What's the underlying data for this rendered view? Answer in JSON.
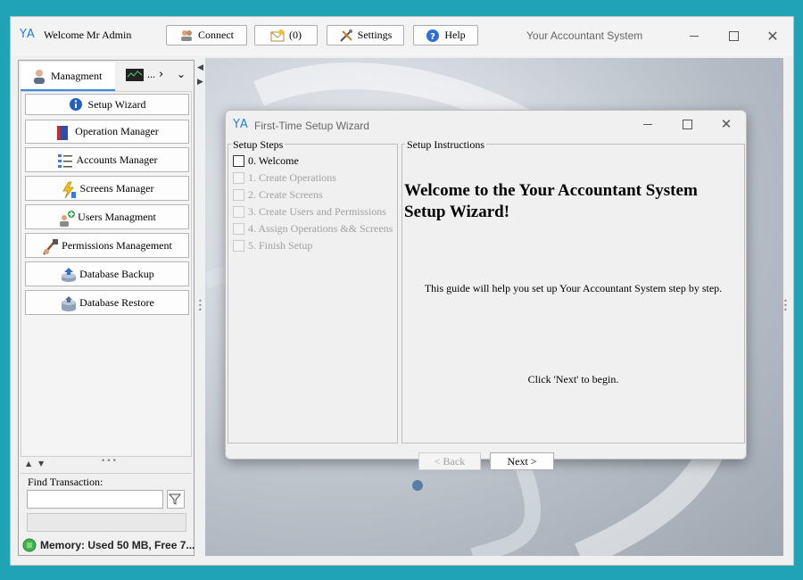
{
  "app": {
    "logo": "YA",
    "welcome": "Welcome Mr Admin",
    "title": "Your Accountant System"
  },
  "toolbar": {
    "connect": "Connect",
    "messages": "(0)",
    "settings": "Settings",
    "help": "Help"
  },
  "sidebar": {
    "tab_management": "Managment",
    "tab_more": "...",
    "items": [
      {
        "label": "Setup Wizard",
        "icon": "info-icon"
      },
      {
        "label": "Operation Manager",
        "icon": "book-icon"
      },
      {
        "label": "Accounts Manager",
        "icon": "list-icon"
      },
      {
        "label": "Screens Manager",
        "icon": "lightning-icon"
      },
      {
        "label": "Users Managment",
        "icon": "users-icon"
      },
      {
        "label": "Permissions Management",
        "icon": "permissions-icon"
      },
      {
        "label": "Database Backup",
        "icon": "database-backup-icon"
      },
      {
        "label": "Database Restore",
        "icon": "database-restore-icon"
      }
    ],
    "find_label": "Find Transaction:",
    "find_value": "",
    "memory": "Memory: Used 50 MB, Free 7..."
  },
  "wizard": {
    "logo": "YA",
    "title": "First-Time Setup Wizard",
    "steps_label": "Setup Steps",
    "steps": [
      {
        "label": "0. Welcome",
        "enabled": true
      },
      {
        "label": "1. Create Operations",
        "enabled": false
      },
      {
        "label": "2. Create Screens",
        "enabled": false
      },
      {
        "label": "3. Create Users and Permissions",
        "enabled": false
      },
      {
        "label": "4. Assign Operations && Screens",
        "enabled": false
      },
      {
        "label": "5. Finish Setup",
        "enabled": false
      }
    ],
    "instructions_label": "Setup Instructions",
    "heading_line1": "Welcome to the Your Accountant System",
    "heading_line2": "Setup Wizard!",
    "guide_text": "This guide will help you set up Your Accountant System step by step.",
    "next_hint": "Click 'Next' to begin.",
    "back_label": "< Back",
    "next_label": "Next >"
  },
  "colors": {
    "accent": "#3c8ce0",
    "frame": "#1fa3b5",
    "disabled_text": "#a0a0a0"
  }
}
